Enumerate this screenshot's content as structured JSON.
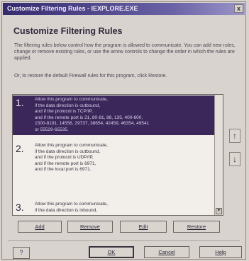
{
  "window": {
    "title": "Customize Filtering Rules - IEXPLORE.EXE",
    "close_label": "x"
  },
  "heading": "Customize Filtering Rules",
  "description": "The filtering rules below control how the program is allowed to communicate. You can add new rules, change or remove existing rules, or use the arrow controls to change the order in which the rules are applied.",
  "restore_note": "Or, to restore the default Firewall rules for this program, click Restore.",
  "rules": [
    {
      "number": "1.",
      "selected": true,
      "lines": [
        "Allow this program to communicate,",
        "if the data direction is outbound,",
        "and if the protocol is TCP/IP,",
        "and if the remote port is 21, 80-81, 88, 135, 400-600,",
        "1500-8191, 14556, 29737, 38654, 42459, 46354, 49541",
        "or 55529-65535."
      ]
    },
    {
      "number": "2.",
      "selected": false,
      "lines": [
        "Allow this program to communicate,",
        "if the data direction is outbound,",
        "and if the protocol is UDP/IP,",
        "and if the remote port is 6971,",
        "and if the local port is 6971."
      ]
    },
    {
      "number": "3.",
      "selected": false,
      "lines": [
        "Allow this program to communicate,",
        "if the data direction is inbound,"
      ]
    }
  ],
  "buttons": {
    "add": "Add",
    "remove": "Remove",
    "edit": "Edit",
    "restore": "Restore",
    "ok": "OK",
    "cancel": "Cancel",
    "help": "Help"
  },
  "icons": {
    "move_up": "arrow-up-icon",
    "move_down": "arrow-down-icon",
    "scroll_down": "scroll-down-icon",
    "help": "help-icon"
  },
  "glyphs": {
    "move_up": "↑",
    "move_down": "↓",
    "scroll_down": "▼",
    "help": "?"
  },
  "colors": {
    "title_bar": "#352a6e",
    "selection": "#3b2759",
    "dialog_bg": "#d8d3cf"
  }
}
